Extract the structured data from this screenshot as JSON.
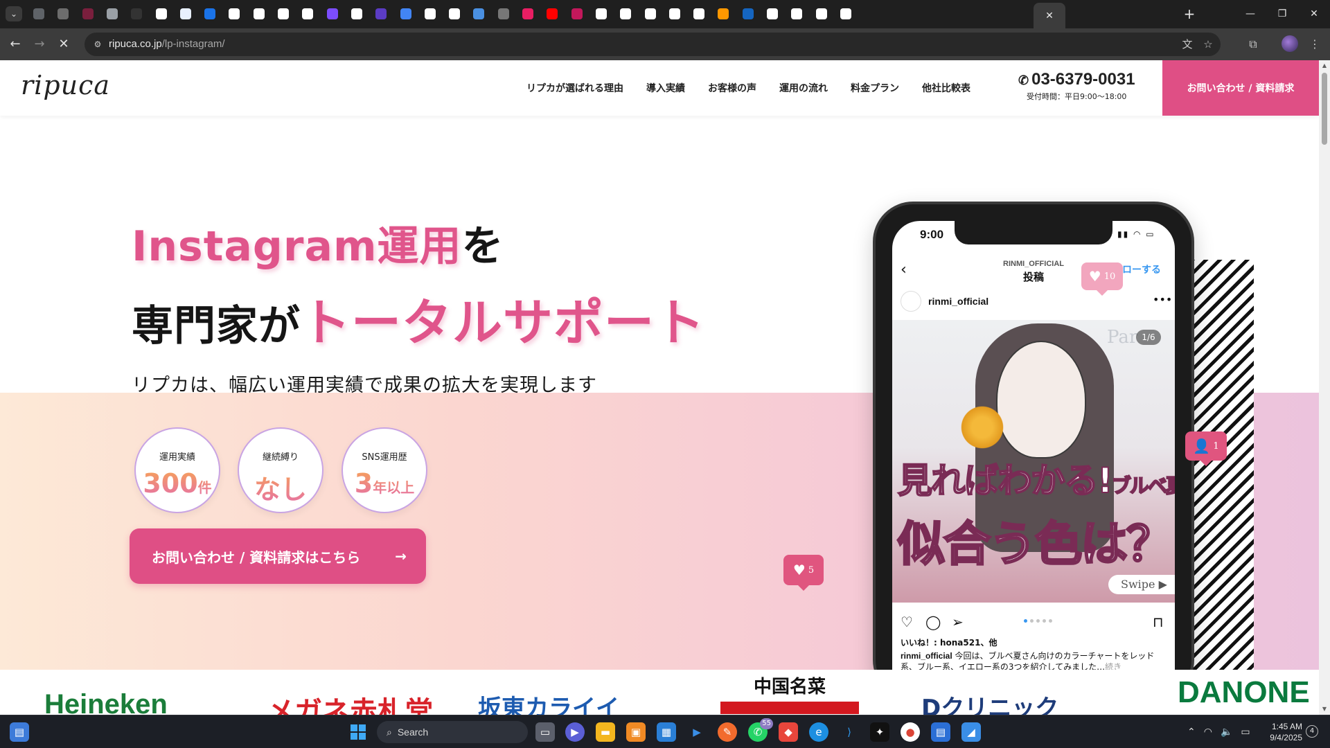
{
  "browser": {
    "url_host": "ripuca.co.jp",
    "url_path": "/lp-instagram/",
    "pinned_tab_colors": [
      "#5f6368",
      "#6d6d6d",
      "#7a1f3d",
      "#9aa0a6",
      "#333333",
      "#ffffff",
      "#e8f0fe",
      "#1a73e8",
      "#ffffff",
      "#ffffff",
      "#ffffff",
      "#ffffff",
      "#7c4dff",
      "#ffffff",
      "#5b3cc4",
      "#4285f4",
      "#ffffff",
      "#ffffff",
      "#4a90e2",
      "#777777",
      "#e91e63",
      "#ff0000",
      "#c2185b",
      "#ffffff",
      "#ffffff",
      "#ffffff",
      "#ffffff",
      "#ffffff",
      "#ff9800",
      "#1565c0",
      "#ffffff",
      "#ffffff",
      "#ffffff",
      "#ffffff"
    ],
    "active_tab_close": "✕",
    "new_tab": "+",
    "window_controls": [
      "—",
      "❐",
      "✕"
    ]
  },
  "site": {
    "logo": "ripuca",
    "nav": [
      "リプカが選ばれる理由",
      "導入実績",
      "お客様の声",
      "運用の流れ",
      "料金プラン",
      "他社比較表"
    ],
    "phone": "03-6379-0031",
    "hours": "受付時間：平日9:00〜18:00",
    "header_cta": "お問い合わせ / 資料請求"
  },
  "hero": {
    "line1_pink": "Instagram運用",
    "line1_dark": "を",
    "line2_dark": "専門家が",
    "line2_pink": "トータルサポート",
    "sub": "リプカは、幅広い運用実績で成果の拡大を実現します",
    "badges": [
      {
        "label": "運用実績",
        "value": "300",
        "unit": "件"
      },
      {
        "label": "継続縛り",
        "value": "なし",
        "unit": ""
      },
      {
        "label": "SNS運用歴",
        "value": "3",
        "unit": "年以上"
      }
    ],
    "cta": "お問い合わせ / 資料請求はこちら",
    "cta_arrow": "→"
  },
  "phone_mock": {
    "time": "9:00",
    "account_caps": "RINMI_OFFICIAL",
    "post_label": "投稿",
    "follow": "フォローする",
    "username": "rinmi_official",
    "image_counter": "1/6",
    "image_tag": "Par",
    "image_text1": "見ればわかる!",
    "image_text1_small": "ブルベ夏さん",
    "image_text2": "似合う色は？",
    "swipe": "Swipe ▶",
    "likes": "いいね！: hona521、他",
    "caption_user": "rinmi_official",
    "caption": "今回は、ブルベ夏さん向けのカラーチャートをレッド系、ブルー系、イエロー系の3つを紹介してみました…",
    "caption_more": "続き"
  },
  "bubbles": {
    "likes_top": "10",
    "followers": "1",
    "likes_bottom": "5"
  },
  "logos": [
    "Heineken",
    "メガネ赤札堂",
    "坂東カライイ",
    "中国名菜",
    "Dクリニック",
    "DANONE BIO"
  ],
  "taskbar": {
    "search_placeholder": "Search",
    "whatsapp_badge": "55",
    "time": "1:45 AM",
    "date": "9/4/2025",
    "notifications": "4"
  }
}
